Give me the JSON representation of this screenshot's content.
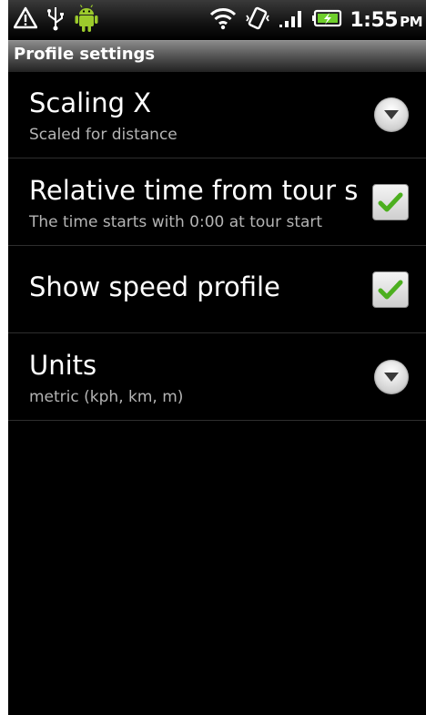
{
  "status_bar": {
    "time": "1:55",
    "ampm": "PM",
    "icons": [
      "warning-icon",
      "usb-icon",
      "android-icon",
      "wifi-icon",
      "vibrate-icon",
      "signal-icon",
      "battery-icon"
    ]
  },
  "title_bar": {
    "title": "Profile settings"
  },
  "preferences": [
    {
      "label": "Scaling X",
      "summary": "Scaled for distance",
      "widget": "dropdown"
    },
    {
      "label": "Relative time from tour start",
      "summary": "The time starts with 0:00 at tour start",
      "widget": "checkbox",
      "checked": true
    },
    {
      "label": "Show speed profile",
      "summary": "",
      "widget": "checkbox",
      "checked": true
    },
    {
      "label": "Units",
      "summary": "metric (kph, km, m)",
      "widget": "dropdown"
    }
  ],
  "colors": {
    "background": "#000000",
    "text": "#ffffff",
    "summary_text": "#b4b4b4",
    "divider": "#2e2e2e",
    "check_green": "#4caf1f"
  }
}
